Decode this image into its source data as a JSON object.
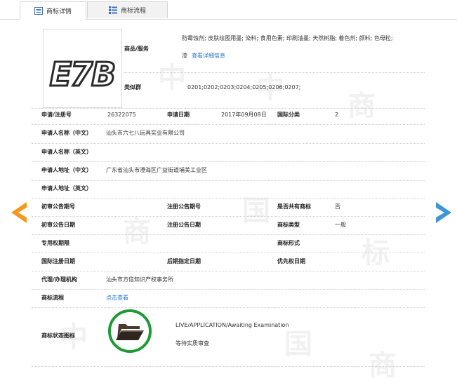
{
  "tabs": [
    {
      "label": "商标详情",
      "icon": "list-icon",
      "active": true
    },
    {
      "label": "商标流程",
      "icon": "table-icon",
      "active": false
    }
  ],
  "trademark": {
    "logo_text": "E7B",
    "goods_label": "商品/服务",
    "goods_value_1": "防霉蚀剂; 皮肤绘图用墨; 染料; 食用色素; 印刷油墨; 天然树脂; 着色剂; 颜料; 色母粒;",
    "goods_value_2": "漆",
    "goods_link": "查看详细信息",
    "group_label": "类似群",
    "group_value": "0201;0202;0203;0204;0205;0206;0207;"
  },
  "fields": {
    "reg_no_label": "申请/注册号",
    "reg_no": "26322075",
    "apply_date_label": "申请日期",
    "apply_date": "2017年09月08日",
    "intl_class_label": "国际分类",
    "intl_class": "2",
    "applicant_cn_label": "申请人名称（中文）",
    "applicant_cn": "汕头市六七八玩具实业有限公司",
    "applicant_en_label": "申请人名称（英文）",
    "address_cn_label": "申请人地址（中文）",
    "address_cn": "广东省汕头市澄海区广益街道埔美工业区",
    "address_en_label": "申请人地址（英文）",
    "prelim_pub_no_label": "初审公告期号",
    "reg_pub_no_label": "注册公告期号",
    "shared_label": "是否共有商标",
    "shared": "否",
    "prelim_pub_date_label": "初审公告日期",
    "reg_pub_date_label": "注册公告日期",
    "tm_type_label": "商标类型",
    "tm_type": "一般",
    "exclusive_label": "专用权期限",
    "tm_form_label": "商标形式",
    "intl_reg_date_label": "国际注册日期",
    "later_date_label": "后期指定日期",
    "priority_date_label": "优先权日期",
    "agent_label": "代理/办理机构",
    "agent": "汕头市方信知识产权事务所",
    "process_label": "商标流程",
    "process_link": "点击查看",
    "status_icon_label": "商标状态图标",
    "status_en": "LIVE/APPLICATION/Awaiting Examination",
    "status_cn": "等待实质审查"
  },
  "colors": {
    "arrow_left": "#f39a1e",
    "arrow_right": "#3f97d8",
    "highlight_circle": "#1e9a36",
    "link": "#2b74c7"
  },
  "watermark": [
    "中",
    "国",
    "商",
    "标"
  ]
}
